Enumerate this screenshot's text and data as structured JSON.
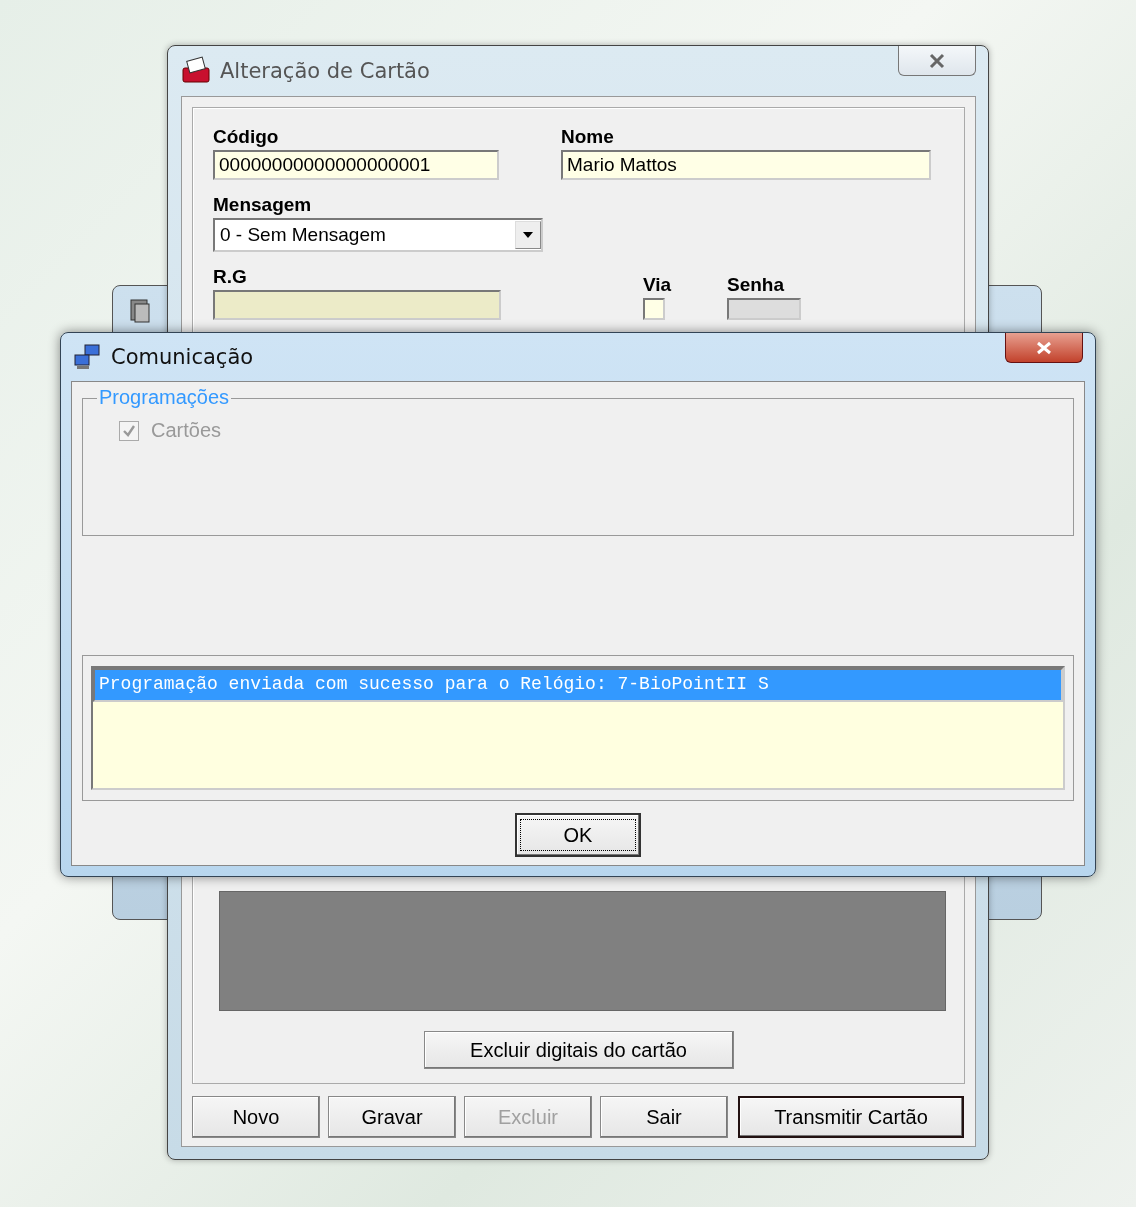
{
  "main_window": {
    "title": "Alteração de Cartão",
    "fields": [
      {
        "label": "Código",
        "value": "00000000000000000001",
        "kind": "text"
      },
      {
        "label": "Nome",
        "value": "Mario Mattos",
        "kind": "text"
      },
      {
        "label": "Mensagem",
        "value": "0 - Sem Mensagem",
        "kind": "select"
      }
    ],
    "rg_label": "R.G",
    "via_label": "Via",
    "senha_label": "Senha",
    "delete_fingerprints_button": "Excluir digitais do cartão",
    "buttons": [
      {
        "label": "Novo",
        "disabled": false,
        "default": false
      },
      {
        "label": "Gravar",
        "disabled": false,
        "default": false
      },
      {
        "label": "Excluir",
        "disabled": true,
        "default": false
      },
      {
        "label": "Sair",
        "disabled": false,
        "default": false
      },
      {
        "label": "Transmitir Cartão",
        "disabled": false,
        "default": true
      }
    ]
  },
  "dialog": {
    "title": "Comunicação",
    "group_title": "Programações",
    "checkbox": {
      "label": "Cartões",
      "checked": true,
      "disabled": true
    },
    "log": [
      {
        "text": "Programação enviada com sucesso para o Relógio: 7-BioPointII S",
        "selected": true
      }
    ],
    "ok_button": "OK"
  }
}
